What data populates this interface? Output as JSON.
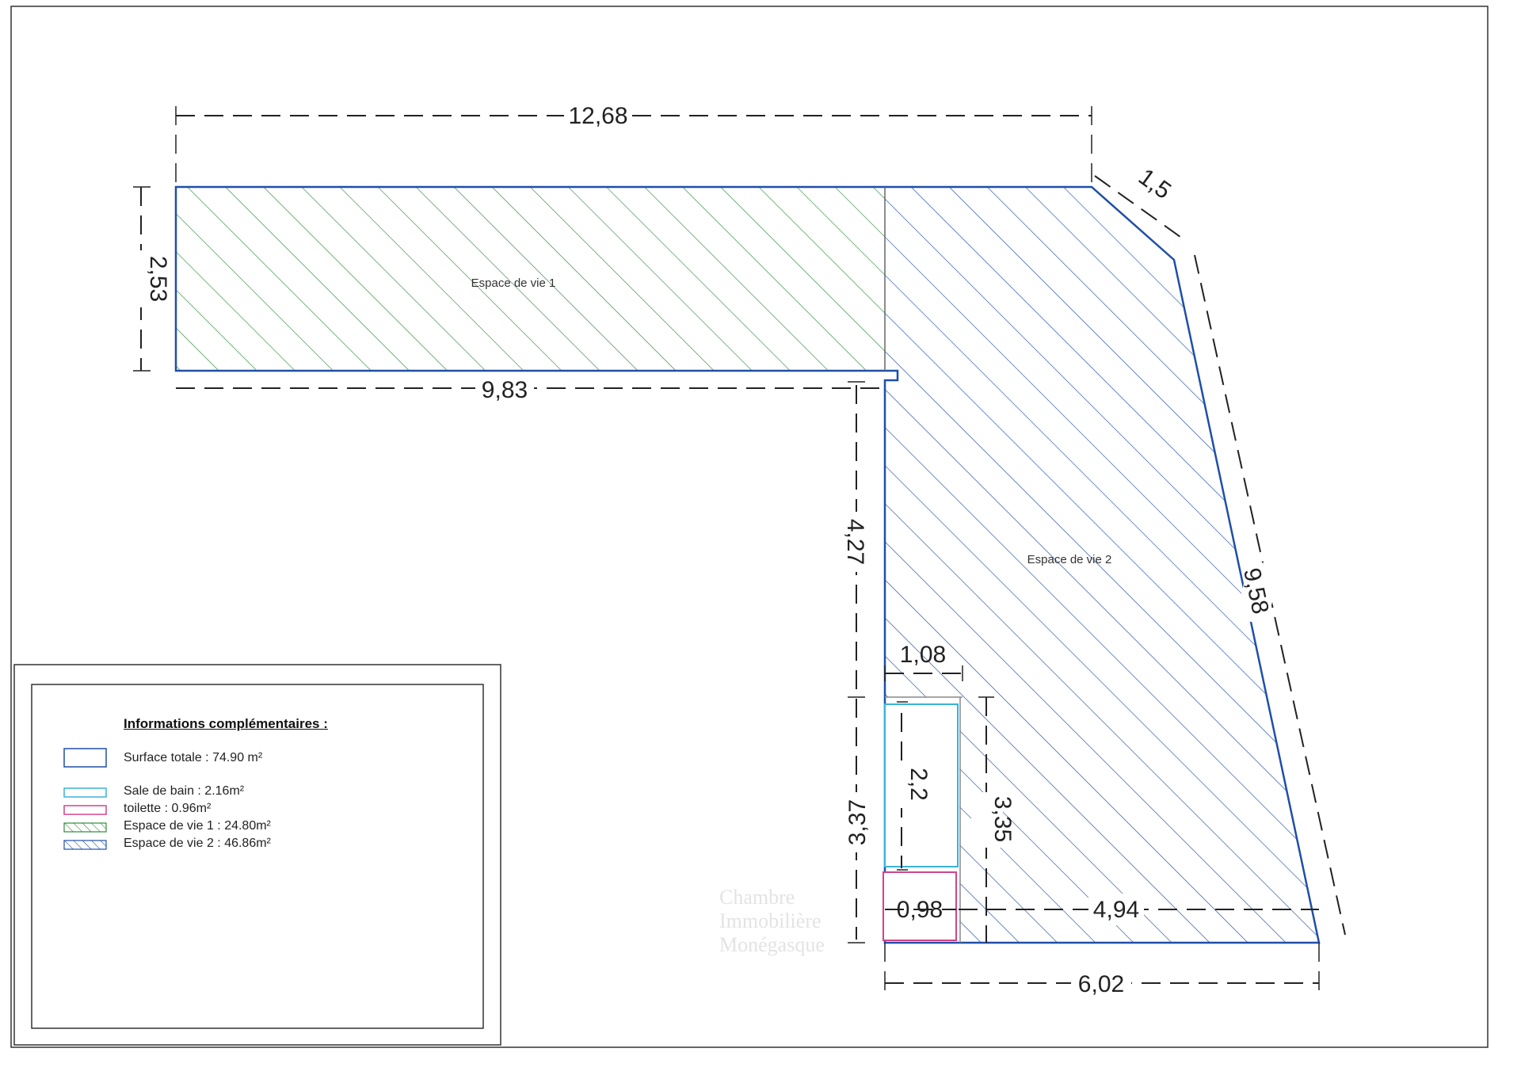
{
  "dimensions": {
    "top_width": "12,68",
    "left_height": "2,53",
    "bottom_left": "9,83",
    "chamfer": "1,5",
    "diagonal": "9,58",
    "vertical_upper": "4,27",
    "vertical_lower": "3,37",
    "bath_width": "1,08",
    "bath_height": "2,2",
    "bath_right_height": "3,35",
    "toilet_width": "0,98",
    "bottom_inner": "4,94",
    "bottom_total": "6,02"
  },
  "rooms": {
    "espace1_label": "Espace de vie 1",
    "espace2_label": "Espace de vie 2"
  },
  "legend": {
    "title": "Informations complémentaires :",
    "total": "Surface totale : 74.90 m²",
    "bath": "Sale de bain : 2.16m²",
    "toilet": "toilette : 0.96m²",
    "espace1": "Espace de vie 1 : 24.80m²",
    "espace2": "Espace de vie 2 : 46.86m²"
  },
  "watermark": [
    "Chambre",
    "Immobilière",
    "Monégasque"
  ],
  "colors": {
    "outline": "#1f4fa8",
    "espace1_hatch": "#2e8b3a",
    "espace2_hatch": "#1f4fa8",
    "bath": "#39b3d9",
    "toilet": "#d1458a"
  }
}
